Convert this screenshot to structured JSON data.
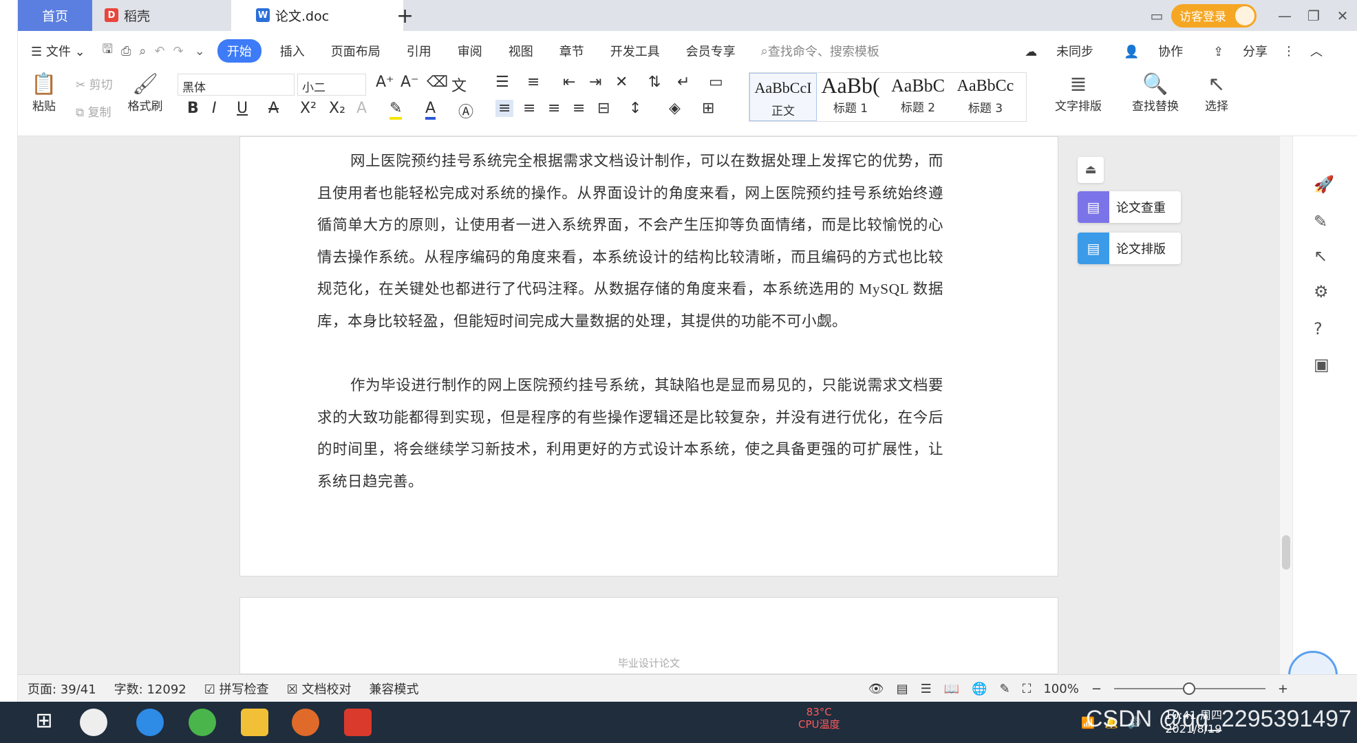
{
  "tabs": {
    "home": "首页",
    "docer": "稻壳",
    "doc": "论文.doc",
    "login": "访客登录"
  },
  "menu": {
    "file": "文件",
    "items": [
      "开始",
      "插入",
      "页面布局",
      "引用",
      "审阅",
      "视图",
      "章节",
      "开发工具",
      "会员专享"
    ],
    "search_placeholder": "查找命令、搜索模板",
    "sync": "未同步",
    "collab": "协作",
    "share": "分享"
  },
  "ribbon": {
    "paste": "粘贴",
    "cut": "剪切",
    "copy": "复制",
    "format_painter": "格式刷",
    "font": "黑体",
    "size": "小二",
    "styles": [
      {
        "sample": "AaBbCcI",
        "label": "正文"
      },
      {
        "sample": "AaBb(",
        "label": "标题 1"
      },
      {
        "sample": "AaBbC",
        "label": "标题 2"
      },
      {
        "sample": "AaBbCc",
        "label": "标题 3"
      }
    ],
    "text_layout": "文字排版",
    "find_replace": "查找替换",
    "select": "选择"
  },
  "document": {
    "paragraph1": "网上医院预约挂号系统完全根据需求文档设计制作，可以在数据处理上发挥它的优势，而且使用者也能轻松完成对系统的操作。从界面设计的角度来看，网上医院预约挂号系统始终遵循简单大方的原则，让使用者一进入系统界面，不会产生压抑等负面情绪，而是比较愉悦的心情去操作系统。从程序编码的角度来看，本系统设计的结构比较清晰，而且编码的方式也比较规范化，在关键处也都进行了代码注释。从数据存储的角度来看，本系统选用的 MySQL 数据库，本身比较轻盈，但能短时间完成大量数据的处理，其提供的功能不可小觑。",
    "paragraph2": "作为毕设进行制作的网上医院预约挂号系统，其缺陷也是显而易见的，只能说需求文档要求的大致功能都得到实现，但是程序的有些操作逻辑还是比较复杂，并没有进行优化，在今后的时间里，将会继续学习新技术，利用更好的方式设计本系统，使之具备更强的可扩展性，让系统日趋完善。",
    "page2_header": "毕业设计论文"
  },
  "side_panel": {
    "check": "论文查重",
    "layout": "论文排版"
  },
  "status": {
    "page": "页面: 39/41",
    "words": "字数: 12092",
    "spell": "拼写检查",
    "proof": "文档校对",
    "compat": "兼容模式",
    "zoom": "100%"
  },
  "taskbar": {
    "cpu_temp": "83°C",
    "cpu_label": "CPU温度",
    "time": "10:41 周四",
    "date": "2021/8/19",
    "watermark": "CSDN @qq_2295391497"
  },
  "colors": {
    "accent": "#3d7bf7",
    "home_tab": "#5b7fe0",
    "login": "#f5a623",
    "check_icon": "#7b74e8",
    "layout_icon": "#3b9be8"
  }
}
